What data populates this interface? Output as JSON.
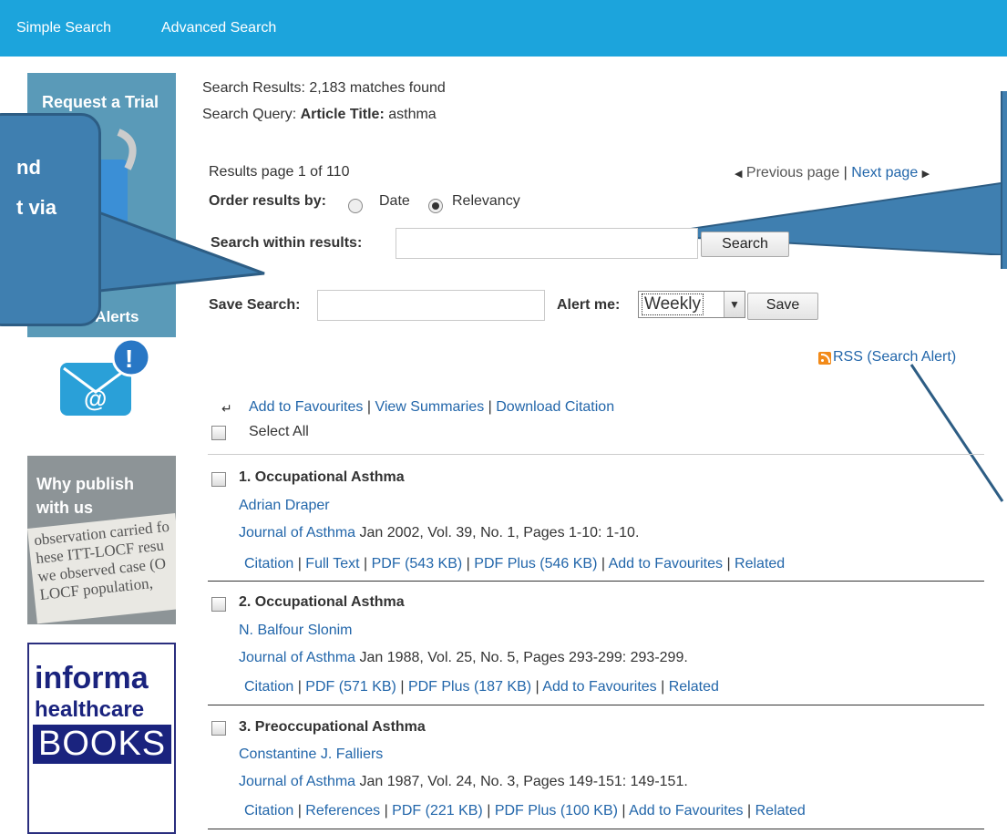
{
  "nav": {
    "simple": "Simple Search",
    "advanced": "Advanced Search"
  },
  "sidebar": {
    "trial": "Request a Trial",
    "alerts": "Content Alerts",
    "publish_line1": "Why publish",
    "publish_line2": "with us",
    "paper_text": "observation carried fo\nhese ITT-LOCF resu\nwe observed case (O\nLOCF population,",
    "books_l1": "informa",
    "books_l2": "healthcare",
    "books_l3": "BOOKS"
  },
  "tooltip": {
    "line1": "nd",
    "line2": "t via"
  },
  "summary": {
    "results_line": "Search Results: 2,183 matches found",
    "query_prefix": "Search Query:",
    "query_field": "Article Title:",
    "query_value": "asthma",
    "page_info": "Results page 1 of 110",
    "prev": "Previous page",
    "sep": "|",
    "next": "Next page",
    "order_label": "Order results by:",
    "order_date": "Date",
    "order_relevancy": "Relevancy",
    "within_label": "Search within results:",
    "within_value": "",
    "search_btn": "Search",
    "save_label": "Save Search:",
    "save_value": "",
    "alert_label": "Alert me:",
    "alert_value": "Weekly",
    "save_btn": "Save",
    "rss": "RSS (Search Alert)"
  },
  "actions": {
    "add_fav": "Add to Favourites",
    "view_summaries": "View Summaries",
    "download_citation": "Download Citation",
    "select_all": "Select All"
  },
  "results": [
    {
      "title": "1. Occupational Asthma",
      "author": "Adrian Draper",
      "journal": "Journal of Asthma",
      "meta": " Jan 2002, Vol. 39, No. 1, Pages 1-10: 1-10.",
      "links": [
        "Citation",
        "Full Text",
        "PDF (543 KB)",
        "PDF Plus (546 KB)",
        "Add to Favourites",
        "Related"
      ]
    },
    {
      "title": "2. Occupational Asthma",
      "author": "N. Balfour Slonim",
      "journal": "Journal of Asthma",
      "meta": " Jan 1988, Vol. 25, No. 5, Pages 293-299: 293-299.",
      "links": [
        "Citation",
        "PDF (571 KB)",
        "PDF Plus (187 KB)",
        "Add to Favourites",
        "Related"
      ]
    },
    {
      "title": "3. Preoccupational Asthma",
      "author": "Constantine J. Falliers",
      "journal": "Journal of Asthma",
      "meta": " Jan 1987, Vol. 24, No. 3, Pages 149-151: 149-151.",
      "links": [
        "Citation",
        "References",
        "PDF (221 KB)",
        "PDF Plus (100 KB)",
        "Add to Favourites",
        "Related"
      ]
    }
  ]
}
